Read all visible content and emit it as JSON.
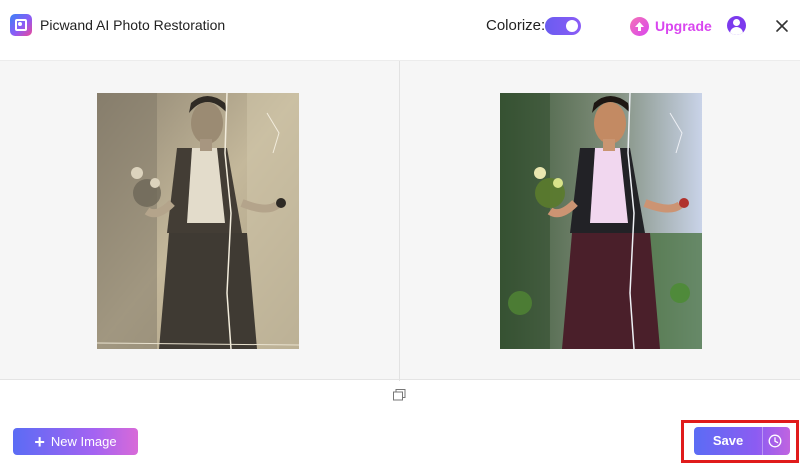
{
  "app": {
    "title": "Picwand AI Photo Restoration",
    "logo_icon": "picwand-logo-icon"
  },
  "header": {
    "colorize_label": "Colorize:",
    "colorize_on": true,
    "upgrade_label": "Upgrade",
    "account_icon": "user-icon",
    "close_icon": "close-icon"
  },
  "preview": {
    "original_alt": "Original black and white photo",
    "restored_alt": "Colorized restored photo",
    "compare_icon": "compare-icon"
  },
  "footer": {
    "new_image_label": "New Image",
    "save_label": "Save",
    "history_icon": "history-icon"
  },
  "colors": {
    "accent": "#7c5cf0",
    "brand_pink": "#d946ef",
    "highlight": "#e01b1b"
  }
}
